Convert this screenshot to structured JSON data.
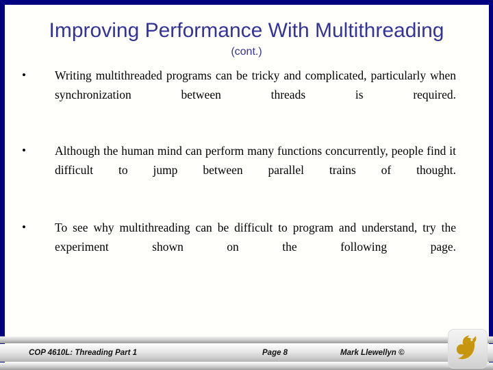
{
  "slide": {
    "title": "Improving Performance With Multithreading",
    "subtitle": "(cont.)",
    "title_color": "#333399",
    "frame_color": "#000080",
    "background_color": "#fffffc",
    "bullet_marker": "•",
    "bullets": [
      {
        "text": "Writing multithreaded programs can be tricky and complicated, particularly when synchronization between threads is required."
      },
      {
        "text": "Although the human mind can perform many functions concurrently, people find it difficult to jump between parallel trains of thought."
      },
      {
        "text": "To see why multithreading can be difficult to program and understand, try the experiment shown on the following page."
      }
    ]
  },
  "footer": {
    "course": "COP 4610L: Threading Part 1",
    "page": "Page 8",
    "author": "Mark Llewellyn ©",
    "logo_name": "ucf-pegasus-logo",
    "logo_color": "#c8960c"
  }
}
